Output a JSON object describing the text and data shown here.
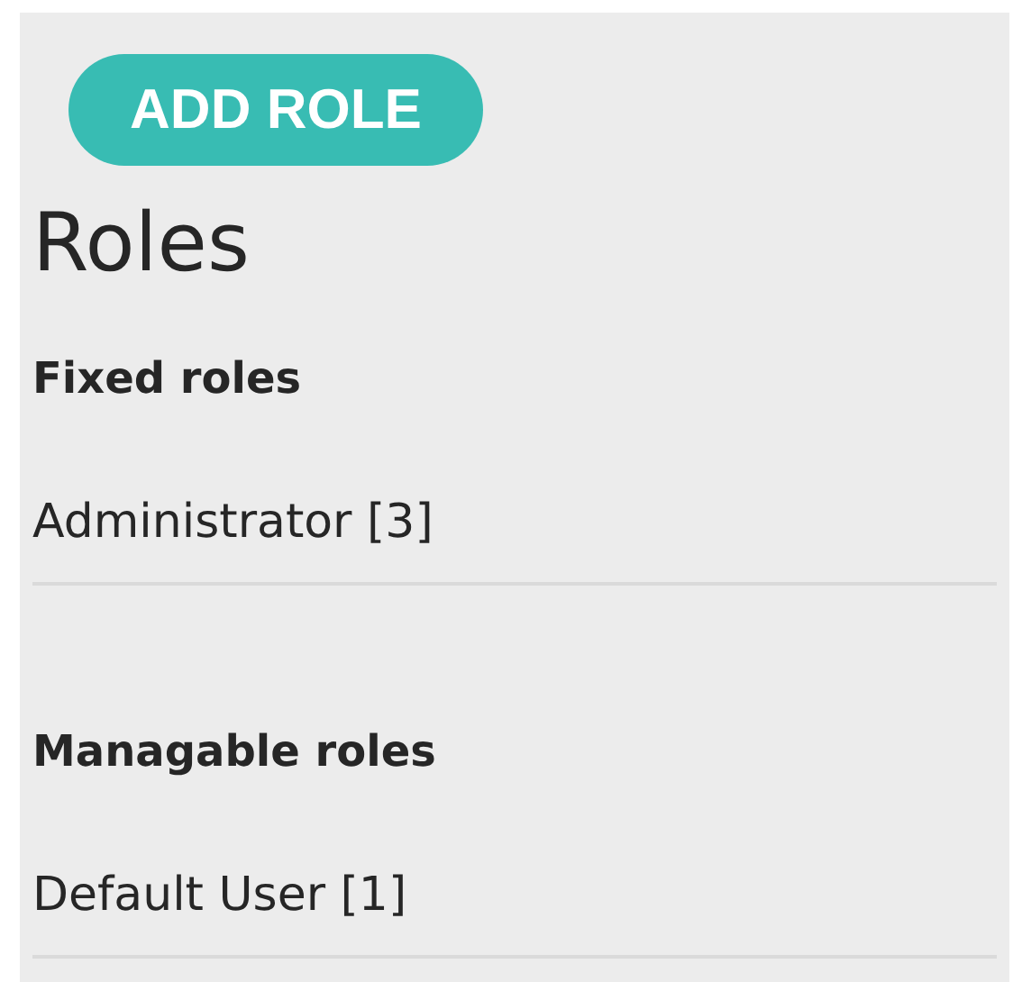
{
  "add_button": {
    "label": "ADD ROLE"
  },
  "title": "Roles",
  "sections": [
    {
      "heading": "Fixed roles",
      "roles": [
        {
          "label": "Administrator [3]"
        }
      ]
    },
    {
      "heading": "Managable roles",
      "roles": [
        {
          "label": "Default User [1]"
        }
      ]
    }
  ]
}
